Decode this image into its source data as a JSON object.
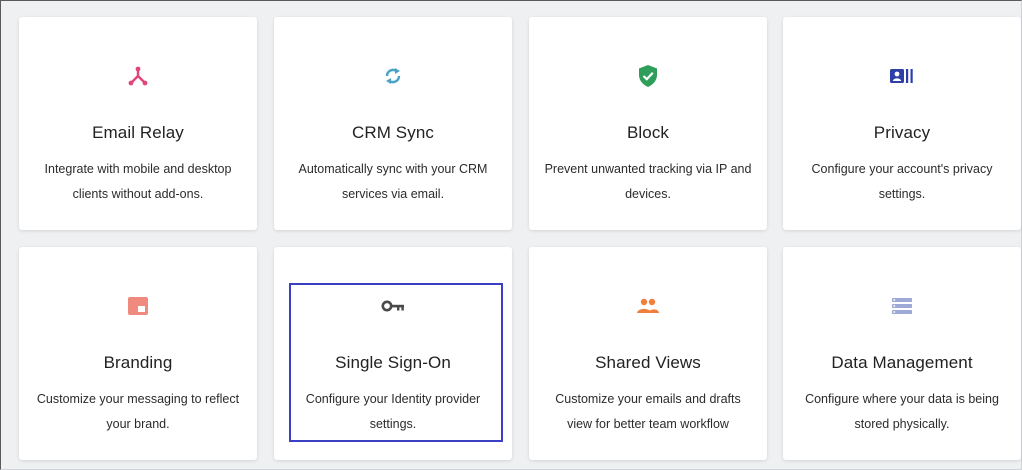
{
  "cards": [
    {
      "name": "card-email-relay",
      "icon": "network-icon",
      "title": "Email Relay",
      "desc": "Integrate with mobile and desktop clients without add-ons."
    },
    {
      "name": "card-crm-sync",
      "icon": "sync-icon",
      "title": "CRM Sync",
      "desc": "Automatically sync with your CRM services via email."
    },
    {
      "name": "card-block",
      "icon": "shield-check-icon",
      "title": "Block",
      "desc": "Prevent unwanted tracking via IP and devices."
    },
    {
      "name": "card-privacy",
      "icon": "id-card-icon",
      "title": "Privacy",
      "desc": "Configure your account's privacy settings."
    },
    {
      "name": "card-branding",
      "icon": "branding-icon",
      "title": "Branding",
      "desc": "Customize your messaging to reflect your brand."
    },
    {
      "name": "card-single-sign-on",
      "icon": "key-icon",
      "title": "Single Sign-On",
      "desc": "Configure your Identity provider settings."
    },
    {
      "name": "card-shared-views",
      "icon": "people-icon",
      "title": "Shared Views",
      "desc": "Customize your emails and drafts view for better team workflow"
    },
    {
      "name": "card-data-management",
      "icon": "storage-icon",
      "title": "Data Management",
      "desc": "Configure where your data is being stored physically."
    }
  ],
  "colors": {
    "network": "#e0457b",
    "sync": "#4aa3c7",
    "shield": "#2f9e5b",
    "id_card": "#2f3fa8",
    "branding": "#f08a7e",
    "key": "#4a4a4a",
    "people": "#f07f3c",
    "storage": "#9fa9d6",
    "selection": "#3b3fc4"
  }
}
